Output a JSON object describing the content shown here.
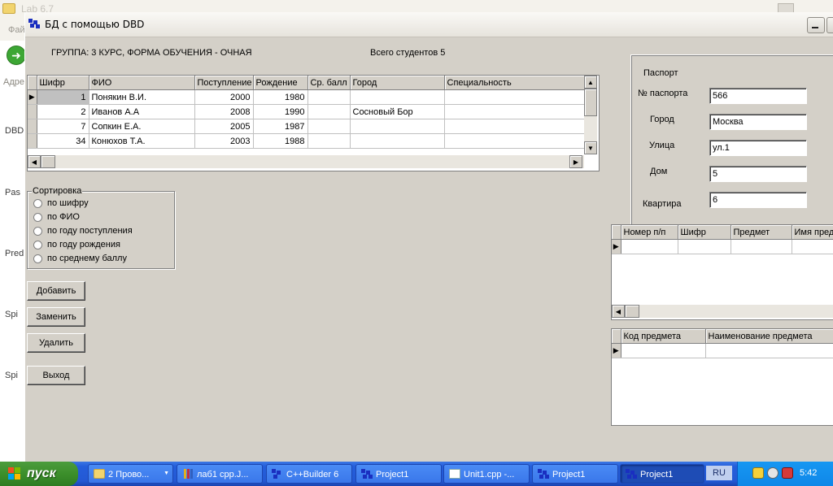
{
  "background_window": {
    "title": "Lab 6.7",
    "menu_fragment": "Фай",
    "address_fragment": "Адре",
    "side_items": [
      "DBD",
      "Pas",
      "Pred",
      "Spi",
      "Spi"
    ]
  },
  "window": {
    "title": "БД с помощью DBD"
  },
  "header": {
    "group_info": "ГРУППА: 3 КУРС, ФОРМА ОБУЧЕНИЯ - ОЧНАЯ",
    "total_students": "Всего студентов 5"
  },
  "students_grid": {
    "columns": [
      "Шифр",
      "ФИО",
      "Поступление",
      "Рождение",
      "Ср. балл",
      "Город",
      "Специальность"
    ],
    "rows": [
      {
        "cipher": "1",
        "name": "Понякин В.И.",
        "admission": "2000",
        "birth": "1980",
        "avg": "",
        "city": "",
        "specialty": ""
      },
      {
        "cipher": "2",
        "name": "Иванов А.А",
        "admission": "2008",
        "birth": "1990",
        "avg": "",
        "city": "Сосновый Бор",
        "specialty": ""
      },
      {
        "cipher": "7",
        "name": "Сопкин Е.А.",
        "admission": "2005",
        "birth": "1987",
        "avg": "",
        "city": "",
        "specialty": ""
      },
      {
        "cipher": "34",
        "name": "Конюхов Т.А.",
        "admission": "2003",
        "birth": "1988",
        "avg": "",
        "city": "",
        "specialty": ""
      }
    ]
  },
  "sorting": {
    "caption": "Сортировка",
    "options": [
      "по шифру",
      "по ФИО",
      "по году поступления",
      "по году рождения",
      "по среднему баллу"
    ]
  },
  "buttons": {
    "add": "Добавить",
    "replace": "Заменить",
    "delete": "Удалить",
    "exit": "Выход"
  },
  "passport": {
    "caption": "Паспорт",
    "number_label": "№ паспорта",
    "number_value": "566",
    "city_label": "Город",
    "city_value": "Москва",
    "street_label": "Улица",
    "street_value": "ул.1",
    "house_label": "Дом",
    "house_value": "5",
    "apartment_label": "Квартира",
    "apartment_value": "6"
  },
  "grades_grid": {
    "columns": [
      "Номер п/п",
      "Шифр",
      "Предмет",
      "Имя пред"
    ]
  },
  "subjects_grid": {
    "columns": [
      "Код предмета",
      "Наименование предмета"
    ]
  },
  "taskbar": {
    "start_label": "пуск",
    "tasks": [
      "2 Прово...",
      "лаб1 cpp.J...",
      "C++Builder 6",
      "Project1",
      "Unit1.cpp -...",
      "Project1",
      "Project1"
    ],
    "task_badge": "2",
    "language": "RU",
    "clock": "5:42"
  },
  "colors": {
    "window_face": "#d4d0c8",
    "taskbar_blue": "#245edb",
    "start_green": "#3c8f2b",
    "tray_blue": "#0f87e8"
  }
}
